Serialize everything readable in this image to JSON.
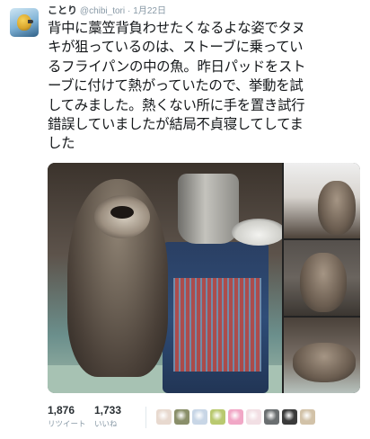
{
  "tweet": {
    "display_name": "ことり",
    "handle": "@chibi_tori",
    "separator": "·",
    "date": "1月22日",
    "text_lines": [
      "背中に藁笠背負わせたくなるよな姿でタヌ",
      "キが狙っているのは、ストーブに乗ってい",
      "るフライパンの中の魚。昨日パッドをスト",
      "ーブに付けて熱がっていたので、挙動を試",
      "してみました。熱くない所に手を置き試行",
      "錯誤していましたが結局不貞寝してしてま",
      "した"
    ],
    "stats": {
      "retweets_count": "1,876",
      "retweets_label": "リツイート",
      "likes_count": "1,733",
      "likes_label": "いいね"
    },
    "liker_avatars": [
      "liker-avatar-1",
      "liker-avatar-2",
      "liker-avatar-3",
      "liker-avatar-4",
      "liker-avatar-5",
      "liker-avatar-6",
      "liker-avatar-7",
      "liker-avatar-8",
      "liker-avatar-9"
    ]
  },
  "colors": {
    "name": "#292f33",
    "meta": "#8899a6",
    "divider": "#e1e8ed",
    "liker_avatars": [
      "#e8d9cf",
      "#8a8f6a",
      "#c8d6e6",
      "#b9c96f",
      "#f1a7c6",
      "#f2dfe4",
      "#6a6e70",
      "#3a3a3a",
      "#d2c2a8"
    ]
  }
}
